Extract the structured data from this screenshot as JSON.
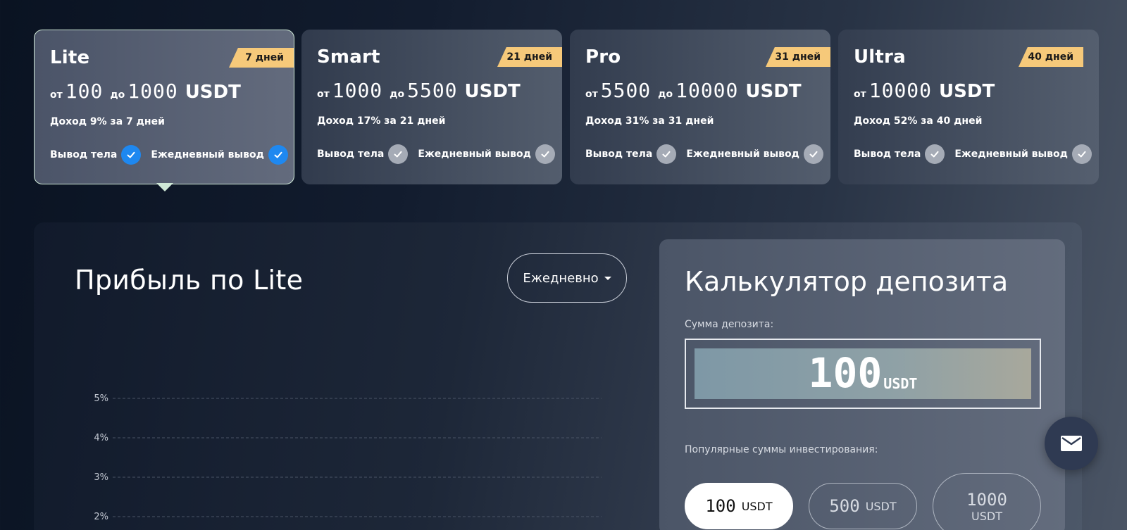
{
  "plans": [
    {
      "name": "Lite",
      "duration": "7 дней",
      "from_prefix": "от",
      "from": "100",
      "to_prefix": "до",
      "to": "1000",
      "currency": "USDT",
      "income": "Доход 9% за 7 дней",
      "feature1": "Вывод тела",
      "feature2": "Ежедневный вывод",
      "active": true
    },
    {
      "name": "Smart",
      "duration": "21 дней",
      "from_prefix": "от",
      "from": "1000",
      "to_prefix": "до",
      "to": "5500",
      "currency": "USDT",
      "income": "Доход 17% за 21 дней",
      "feature1": "Вывод тела",
      "feature2": "Ежедневный вывод",
      "active": false
    },
    {
      "name": "Pro",
      "duration": "31 дней",
      "from_prefix": "от",
      "from": "5500",
      "to_prefix": "до",
      "to": "10000",
      "currency": "USDT",
      "income": "Доход 31% за 31 дней",
      "feature1": "Вывод тела",
      "feature2": "Ежедневный вывод",
      "active": false
    },
    {
      "name": "Ultra",
      "duration": "40 дней",
      "from_prefix": "от",
      "from": "10000",
      "to_prefix": "",
      "to": "",
      "currency": "USDT",
      "income": "Доход 52% за 40 дней",
      "feature1": "Вывод тела",
      "feature2": "Ежедневный вывод",
      "active": false
    }
  ],
  "profit": {
    "title": "Прибыль по Lite",
    "period_select": "Ежедневно"
  },
  "chart_data": {
    "type": "line",
    "y_ticks": [
      "5%",
      "4%",
      "3%",
      "2%"
    ],
    "grid": true,
    "series": []
  },
  "calculator": {
    "title": "Калькулятор депозита",
    "amount_label": "Сумма депозита:",
    "amount_value": "100",
    "amount_currency": "USDT",
    "popular_label": "Популярные суммы инвестирования:",
    "chips": [
      {
        "value": "100",
        "currency": "USDT",
        "selected": true
      },
      {
        "value": "500",
        "currency": "USDT",
        "selected": false
      },
      {
        "value": "1000",
        "currency": "USDT",
        "selected": false
      }
    ]
  },
  "colors": {
    "accent_blue": "#1e88f0",
    "ribbon": "#f6c97a",
    "active_border": "#cfe8d7"
  },
  "icons": {
    "check": "check-icon",
    "mail": "mail-icon",
    "dropdown": "caret-down-icon"
  }
}
